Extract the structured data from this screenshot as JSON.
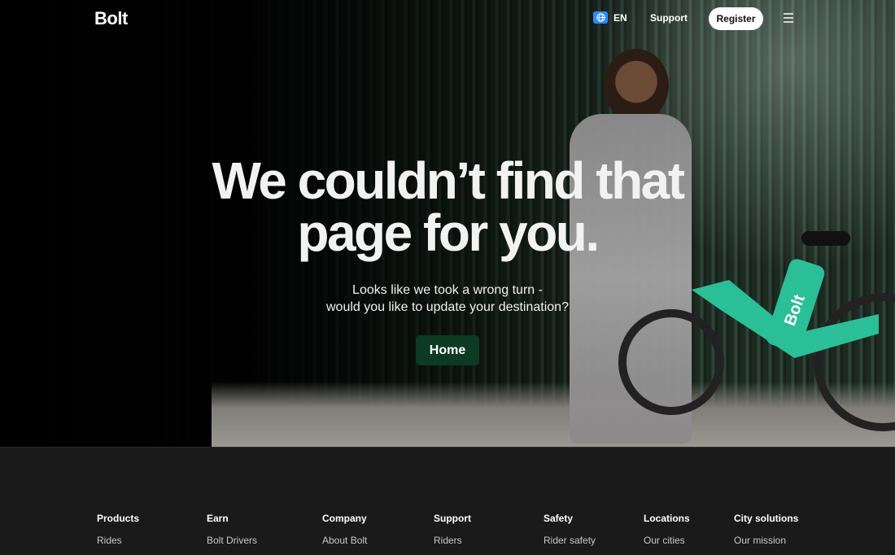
{
  "header": {
    "logo": "Bolt",
    "language": "EN",
    "support": "Support",
    "register": "Register",
    "icons": {
      "language": "globe-icon",
      "menu": "hamburger-menu-icon"
    }
  },
  "hero": {
    "title_line1": "We couldn’t find that",
    "title_line2": "page for you.",
    "subtitle_line1": "Looks like we took a wrong turn -",
    "subtitle_line2": "would you like to update your destination?",
    "home_button": "Home",
    "bike_logo": "Bolt"
  },
  "footer": {
    "columns": [
      {
        "heading": "Products",
        "link": "Rides"
      },
      {
        "heading": "Earn",
        "link": "Bolt Drivers"
      },
      {
        "heading": "Company",
        "link": "About Bolt"
      },
      {
        "heading": "Support",
        "link": "Riders"
      },
      {
        "heading": "Safety",
        "link": "Rider safety"
      },
      {
        "heading": "Locations",
        "link": "Our cities"
      },
      {
        "heading": "City solutions",
        "link": "Our mission"
      }
    ]
  },
  "colors": {
    "brand_green": "#2bbf98",
    "home_button_bg": "#0c3a22",
    "background": "#000000",
    "footer_bg": "#1a1a1a"
  }
}
